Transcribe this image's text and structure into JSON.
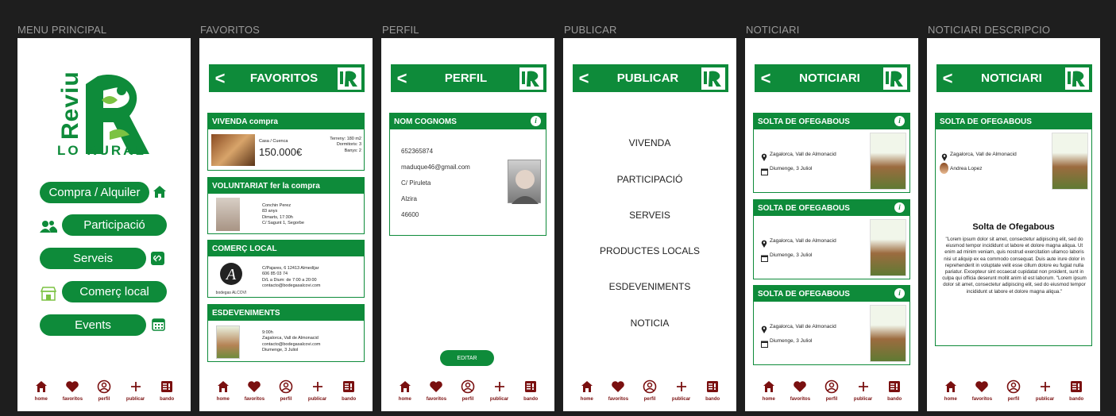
{
  "frames": {
    "menu": {
      "label": "MENU PRINCIPAL"
    },
    "favoritos": {
      "label": "FAVORITOS"
    },
    "perfil": {
      "label": "PERFIL"
    },
    "publicar": {
      "label": "PUBLICAR"
    },
    "noticiari": {
      "label": "NOTICIARI"
    },
    "descripcio": {
      "label": "NOTICIARI DESCRIPCIO"
    }
  },
  "logo": {
    "main": "Reviu",
    "sub": "LO RURAL"
  },
  "menu": {
    "items": [
      "Compra / Alquiler",
      "Participació",
      "Serveis",
      "Comerç local",
      "Events"
    ]
  },
  "tabs": [
    "home",
    "favoritos",
    "perfil",
    "publicar",
    "bando"
  ],
  "favoritos": {
    "title": "FAVORITOS",
    "cards": [
      {
        "title": "VIVENDA compra",
        "line1": "Casa / Cuenca",
        "price": "150.000€",
        "detail1": "Terreny: 180 m2",
        "detail2": "Dormitoris: 3",
        "detail3": "Banys: 2"
      },
      {
        "title": "VOLUNTARIAT fer la compra",
        "l1": "Conchin Perez",
        "l2": "83 anys",
        "l3": "Dimarts, 17:30h",
        "l4": "C/ Sagunt 1, Segorbe"
      },
      {
        "title": "COMERÇ LOCAL",
        "brand": "bodegas ALCOVI",
        "l1": "C/Pajares, 6 12413 Almedíjar",
        "l2": "606 85 03 74",
        "l3": "D/L a Dium: de 7:00 a 20:00",
        "l4": "contacto@bodegasalcovi.com"
      },
      {
        "title": "ESDEVENIMENTS",
        "l1": "9:00h",
        "l2": "Zagalorca, Vall de Almonacid",
        "l3": "contacto@bodegasalcovi.com",
        "l4": "Diumenge, 3 Juliol"
      }
    ]
  },
  "perfil": {
    "title": "PERFIL",
    "card_title": "NOM COGNOMS",
    "fields": [
      "652365874",
      "maduque46@gmail.com",
      "C/ Piruleta",
      "Alzira",
      "46600"
    ],
    "edit": "EDITAR"
  },
  "publicar": {
    "title": "PUBLICAR",
    "items": [
      "VIVENDA",
      "PARTICIPACIÓ",
      "SERVEIS",
      "PRODUCTES LOCALS",
      "ESDEVENIMENTS",
      "NOTICIA"
    ]
  },
  "noticiari": {
    "title": "NOTICIARI",
    "news": [
      {
        "title": "SOLTA DE OFEGABOUS",
        "place": "Zagalorca, Vall de Almonacid",
        "date": "Diumenge, 3 Juliol"
      },
      {
        "title": "SOLTA DE OFEGABOUS",
        "place": "Zagalorca, Vall de Almonacid",
        "date": "Diumenge, 3 Juliol"
      },
      {
        "title": "SOLTA DE OFEGABOUS",
        "place": "Zagalorca, Vall de Almonacid",
        "date": "Diumenge, 3 Juliol"
      }
    ]
  },
  "descripcio": {
    "title": "NOTICIARI",
    "card_title": "SOLTA DE OFEGABOUS",
    "place": "Zagalorca, Vall de Almonacid",
    "author": "Andrea Lopez",
    "heading": "Solta de Ofegabous",
    "body": "\"Lorem ipsum dolor sit amet, consectetur adipiscing elit, sed do eiusmod tempor incididunt ut labore et dolore magna aliqua. Ut enim ad minim veniam, quis nostrud exercitation ullamco laboris nisi ut aliquip ex ea commodo consequat. Duis aute irure dolor in reprehenderit in voluptate velit esse cillum dolore eu fugiat nulla pariatur. Excepteur sint occaecat cupidatat non proident, sunt in culpa qui officia deserunt mollit anim id est laborum. \"Lorem ipsum dolor sit amet, consectetur adipiscing elit, sed do eiusmod tempor incididunt ut labore et dolore magna aliqua.\""
  },
  "colors": {
    "brand_green": "#0e8b3a",
    "tab_red": "#7a1010",
    "background": "#1e1e1e"
  }
}
